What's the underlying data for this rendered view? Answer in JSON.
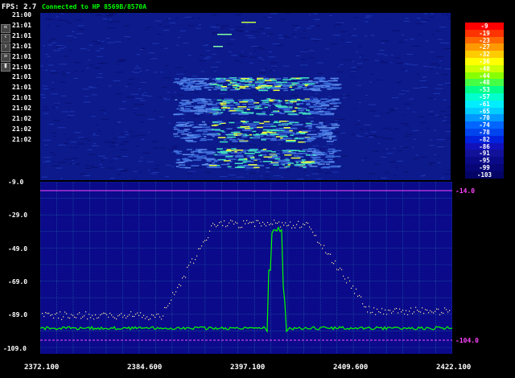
{
  "header": {
    "fps": "FPS: 2.7",
    "status": "Connected to HP 8569B/8570A"
  },
  "nav_buttons": [
    "«",
    "‹",
    "›",
    "»",
    "▮"
  ],
  "timestamps": [
    "21:00",
    "21:01",
    "21:01",
    "21:01",
    "21:01",
    "21:01",
    "21:01",
    "21:01",
    "21:01",
    "21:02",
    "21:02",
    "21:02",
    "21:02"
  ],
  "y_labels": [
    "-9.0",
    "-29.0",
    "-49.0",
    "-69.0",
    "-89.0",
    "-109.0"
  ],
  "ref_labels": {
    "top": "-14.0",
    "bottom": "-104.0"
  },
  "x_labels": [
    "2372.100",
    "2384.600",
    "2397.100",
    "2409.600",
    "2422.100"
  ],
  "legend": {
    "values": [
      "-9",
      "-19",
      "-23",
      "-27",
      "-32",
      "-36",
      "-40",
      "-44",
      "-48",
      "-53",
      "-57",
      "-61",
      "-65",
      "-70",
      "-74",
      "-78",
      "-82",
      "-86",
      "-91",
      "-95",
      "-99",
      "-103"
    ],
    "colors": [
      "#ff0000",
      "#ff3300",
      "#ff6600",
      "#ff9900",
      "#ffcc00",
      "#ffff00",
      "#ccff00",
      "#88ff00",
      "#44ff44",
      "#00ff88",
      "#00ffcc",
      "#00eeff",
      "#00ccff",
      "#0099ff",
      "#0066ff",
      "#0044ee",
      "#0022dd",
      "#1111bb",
      "#111199",
      "#0a0a88",
      "#060677",
      "#040466"
    ]
  },
  "colors": {
    "plot_bg": "#0a0a8a",
    "grid": "#2a66aa",
    "trace_avg": "#00ff00",
    "trace_peak": "#ffe8a0",
    "ref_line": "#ff44ff"
  }
}
